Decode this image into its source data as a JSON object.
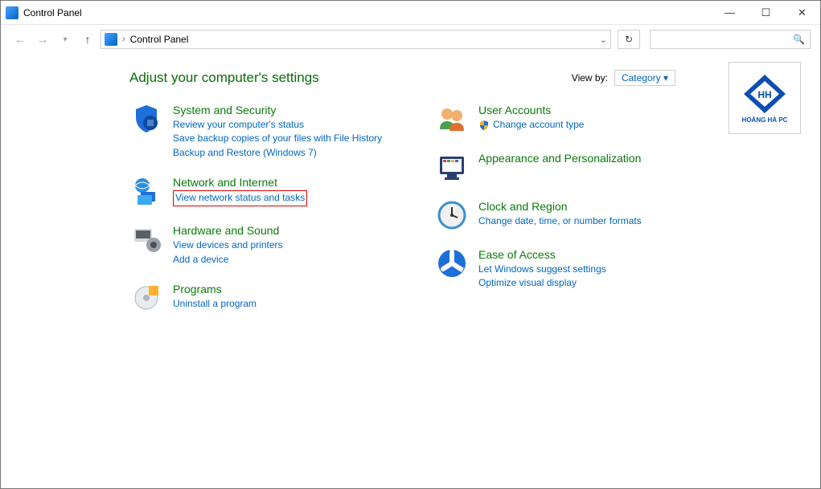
{
  "window": {
    "title": "Control Panel"
  },
  "address": {
    "path": "Control Panel"
  },
  "header": {
    "heading": "Adjust your computer's settings",
    "viewby_label": "View by:",
    "viewby_value": "Category ▾"
  },
  "brand": {
    "text": "HOÀNG HÀ PC"
  },
  "categories_left": [
    {
      "title": "System and Security",
      "links": [
        "Review your computer's status",
        "Save backup copies of your files with File History",
        "Backup and Restore (Windows 7)"
      ]
    },
    {
      "title": "Network and Internet",
      "links": [
        "View network status and tasks"
      ],
      "highlight": true
    },
    {
      "title": "Hardware and Sound",
      "links": [
        "View devices and printers",
        "Add a device"
      ]
    },
    {
      "title": "Programs",
      "links": [
        "Uninstall a program"
      ]
    }
  ],
  "categories_right": [
    {
      "title": "User Accounts",
      "links": [
        "Change account type"
      ],
      "shield": true
    },
    {
      "title": "Appearance and Personalization",
      "links": []
    },
    {
      "title": "Clock and Region",
      "links": [
        "Change date, time, or number formats"
      ]
    },
    {
      "title": "Ease of Access",
      "links": [
        "Let Windows suggest settings",
        "Optimize visual display"
      ]
    }
  ]
}
